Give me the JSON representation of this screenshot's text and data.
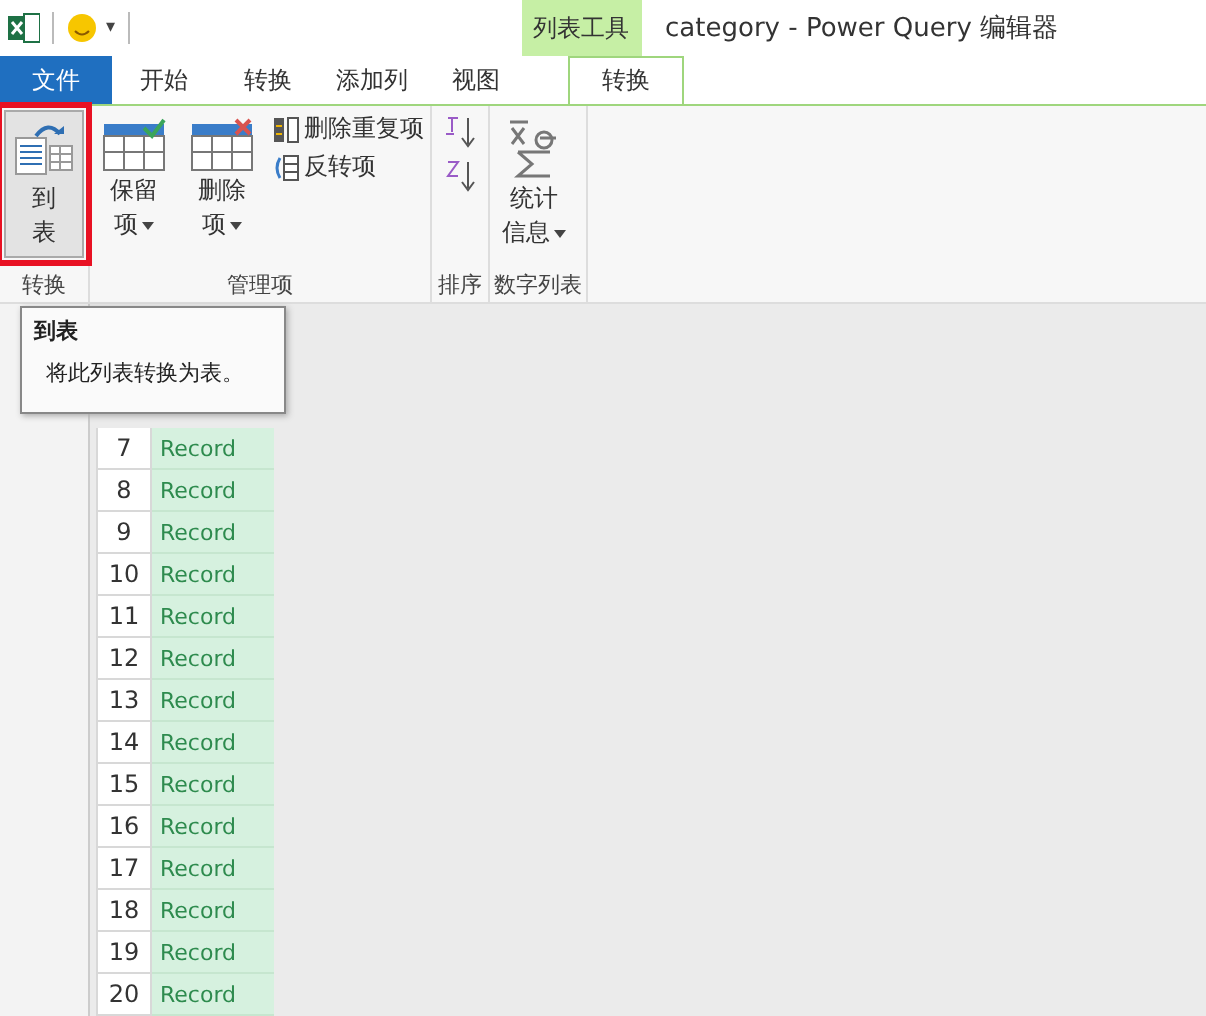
{
  "window": {
    "title": "category - Power Query 编辑器"
  },
  "quick_access": {
    "more": "▾"
  },
  "context_tab_group": {
    "label": "列表工具"
  },
  "tabs": [
    {
      "label": "文件",
      "kind": "file",
      "selected": false
    },
    {
      "label": "开始",
      "kind": "normal",
      "selected": false
    },
    {
      "label": "转换",
      "kind": "normal",
      "selected": false
    },
    {
      "label": "添加列",
      "kind": "normal",
      "selected": false
    },
    {
      "label": "视图",
      "kind": "normal",
      "selected": false
    },
    {
      "label": "转换",
      "kind": "context",
      "selected": true
    }
  ],
  "ribbon_groups": [
    {
      "label": "转换",
      "items": [
        {
          "kind": "large",
          "lines": [
            "到",
            "表"
          ],
          "highlighted": true
        }
      ]
    },
    {
      "label": "管理项",
      "items": [
        {
          "kind": "large",
          "lines": [
            "保留",
            "项"
          ],
          "dropdown": true,
          "highlighted": false
        },
        {
          "kind": "large",
          "lines": [
            "删除",
            "项"
          ],
          "dropdown": true,
          "highlighted": false
        },
        {
          "kind": "small-stack",
          "buttons": [
            {
              "label": "删除重复项"
            },
            {
              "label": "反转项"
            }
          ]
        }
      ]
    },
    {
      "label": "排序",
      "items": [
        {
          "kind": "sort"
        }
      ]
    },
    {
      "label": "数字列表",
      "items": [
        {
          "kind": "large",
          "lines": [
            "统计",
            "信息"
          ],
          "dropdown": true,
          "highlighted": false
        }
      ]
    }
  ],
  "tooltip": {
    "title": "到表",
    "text": "将此列表转换为表。"
  },
  "table": {
    "rows": [
      {
        "index": "7",
        "value": "Record"
      },
      {
        "index": "8",
        "value": "Record"
      },
      {
        "index": "9",
        "value": "Record"
      },
      {
        "index": "10",
        "value": "Record"
      },
      {
        "index": "11",
        "value": "Record"
      },
      {
        "index": "12",
        "value": "Record"
      },
      {
        "index": "13",
        "value": "Record"
      },
      {
        "index": "14",
        "value": "Record"
      },
      {
        "index": "15",
        "value": "Record"
      },
      {
        "index": "16",
        "value": "Record"
      },
      {
        "index": "17",
        "value": "Record"
      },
      {
        "index": "18",
        "value": "Record"
      },
      {
        "index": "19",
        "value": "Record"
      },
      {
        "index": "20",
        "value": "Record"
      }
    ]
  }
}
